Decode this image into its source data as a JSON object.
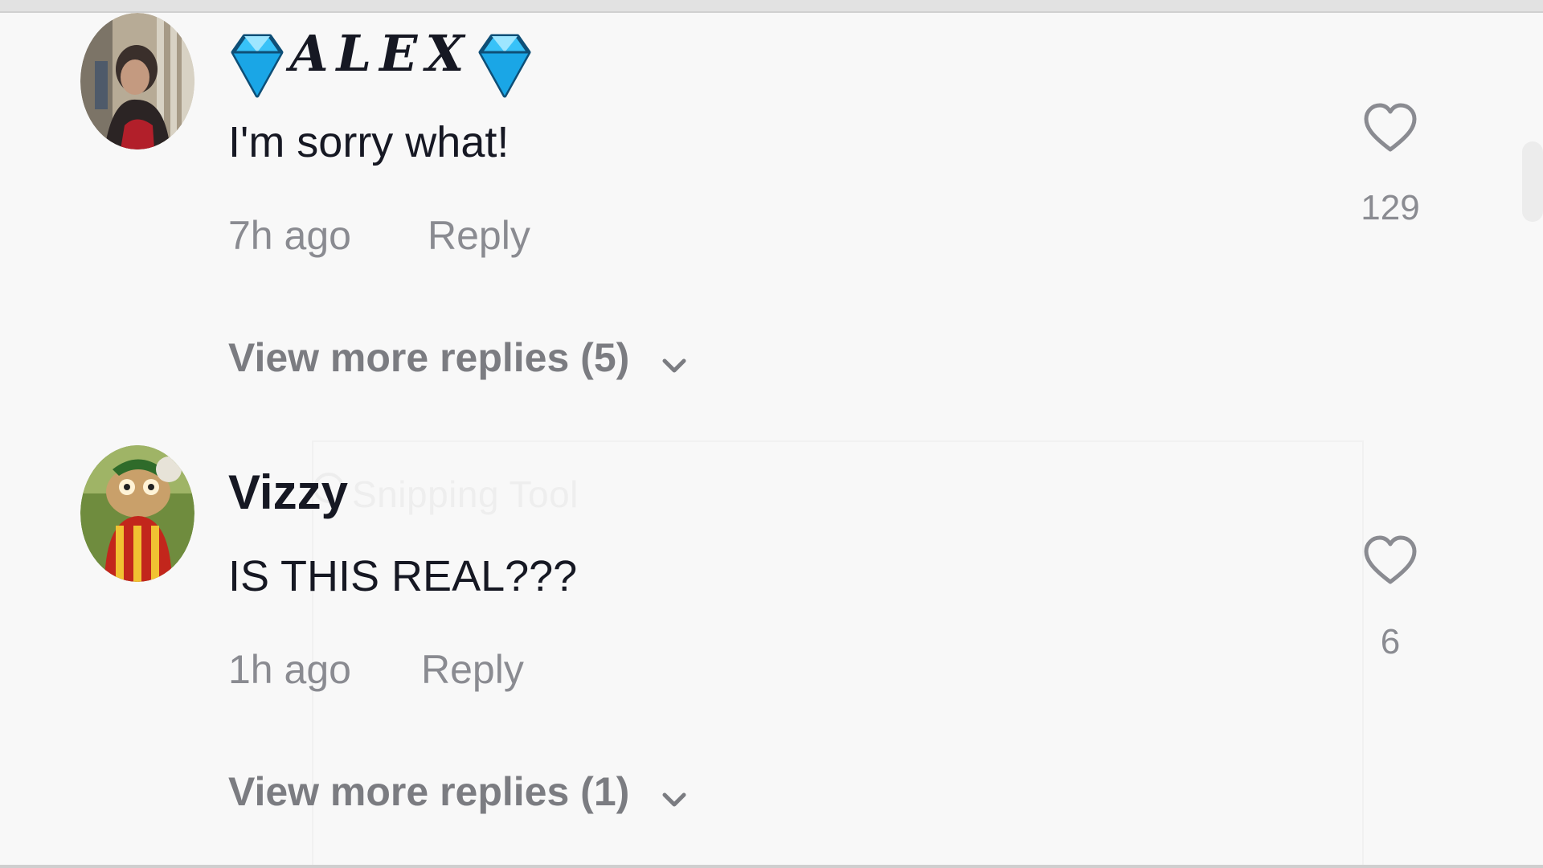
{
  "comments": [
    {
      "username_letters": "ALEX",
      "text": "I'm sorry what!",
      "time": "7h ago",
      "reply_label": "Reply",
      "like_count": "129",
      "view_more": "View more replies (5)",
      "avatar_icon": "avatar-photo"
    },
    {
      "username": "Vizzy",
      "text": "IS THIS REAL???",
      "time": "1h ago",
      "reply_label": "Reply",
      "like_count": "6",
      "view_more": "View more replies (1)",
      "avatar_icon": "avatar-character"
    }
  ],
  "overlay": {
    "title": "Snipping Tool"
  },
  "colors": {
    "background": "#f8f8f8",
    "primary_text": "#161823",
    "secondary_text": "#8a8b91",
    "gem_fill": "#3ec6ff"
  }
}
